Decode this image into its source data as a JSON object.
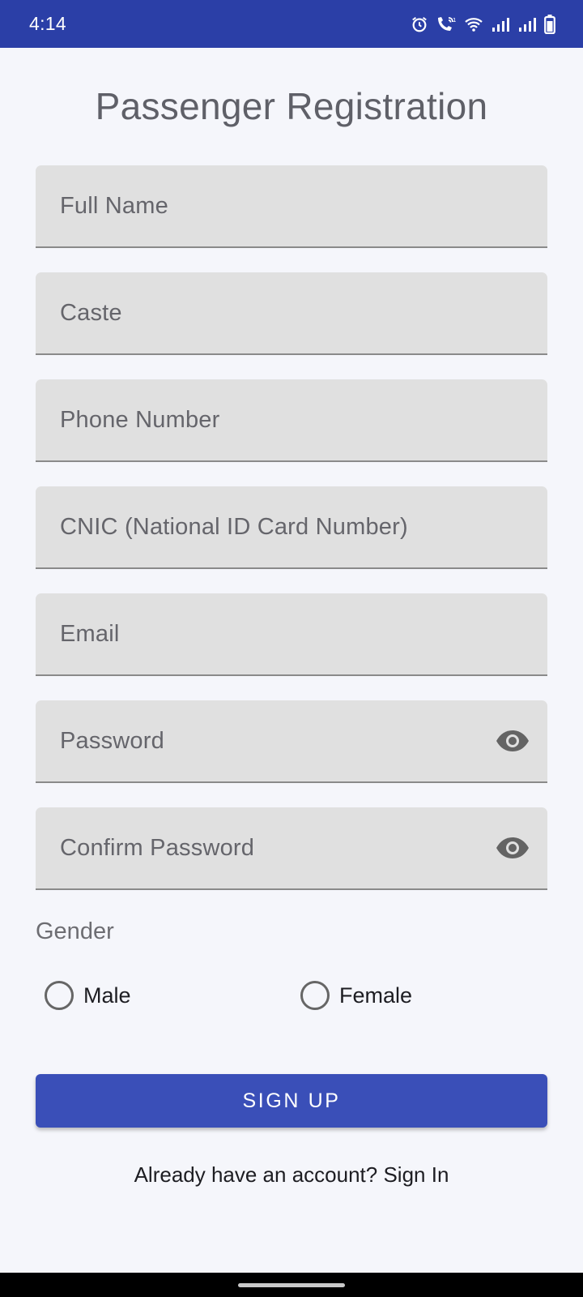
{
  "status_bar": {
    "time": "4:14",
    "icons": [
      "alarm-icon",
      "wifi-calling-icon",
      "wifi-icon",
      "signal-icon",
      "signal-icon",
      "battery-icon"
    ]
  },
  "title": "Passenger Registration",
  "fields": {
    "full_name": "Full Name",
    "caste": "Caste",
    "phone": "Phone Number",
    "cnic": "CNIC (National ID Card Number)",
    "email": "Email",
    "password": "Password",
    "confirm_password": "Confirm Password"
  },
  "gender": {
    "label": "Gender",
    "options": [
      "Male",
      "Female"
    ],
    "selected": null
  },
  "signup_label": "SIGN UP",
  "signin_text": "Already have an account? Sign In",
  "colors": {
    "status_bar": "#2b3fa7",
    "primary": "#3a4fb8",
    "background": "#f5f6fb",
    "field": "#e0e0e0"
  }
}
